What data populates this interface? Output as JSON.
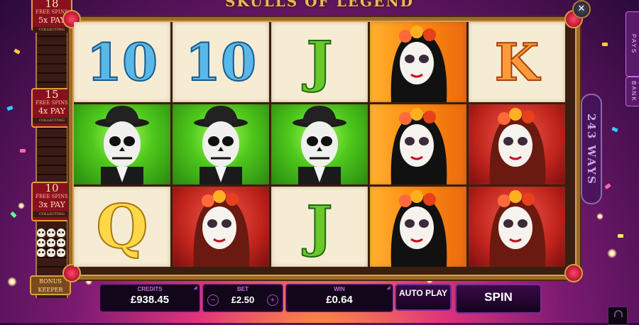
{
  "title": "SKULLS OF LEGEND",
  "side_panel": {
    "tiers": [
      {
        "spins": "18",
        "spins_label": "FREE SPINS",
        "mult": "5x PAY",
        "status": "COLLECTING"
      },
      {
        "spins": "15",
        "spins_label": "FREE SPINS",
        "mult": "4x PAY",
        "status": "COLLECTING"
      },
      {
        "spins": "10",
        "spins_label": "FREE SPINS",
        "mult": "3x PAY",
        "status": "COLLECTING"
      }
    ],
    "bonus_keeper": "BONUS KEEPER"
  },
  "reels": [
    [
      "10",
      "green-skull-man",
      "Q"
    ],
    [
      "10",
      "green-skull-man",
      "red-skull-woman"
    ],
    [
      "J",
      "green-skull-man",
      "J"
    ],
    [
      "orange-skull-woman",
      "orange-skull-woman",
      "orange-skull-woman"
    ],
    [
      "K",
      "red-skull-woman",
      "red-skull-woman"
    ]
  ],
  "ways_label": "243 WAYS",
  "right_tabs": {
    "pays": "PAYS",
    "bank": "BANK"
  },
  "bottom": {
    "credits_label": "CREDITS",
    "credits_value": "£938.45",
    "bet_label": "BET",
    "bet_value": "£2.50",
    "bet_minus": "−",
    "bet_plus": "+",
    "win_label": "WIN",
    "win_value": "£0.64",
    "autoplay_label": "AUTO PLAY",
    "spin_label": "SPIN"
  },
  "colors": {
    "accent": "#7a2a9a",
    "frame": "#9c6a2e"
  }
}
